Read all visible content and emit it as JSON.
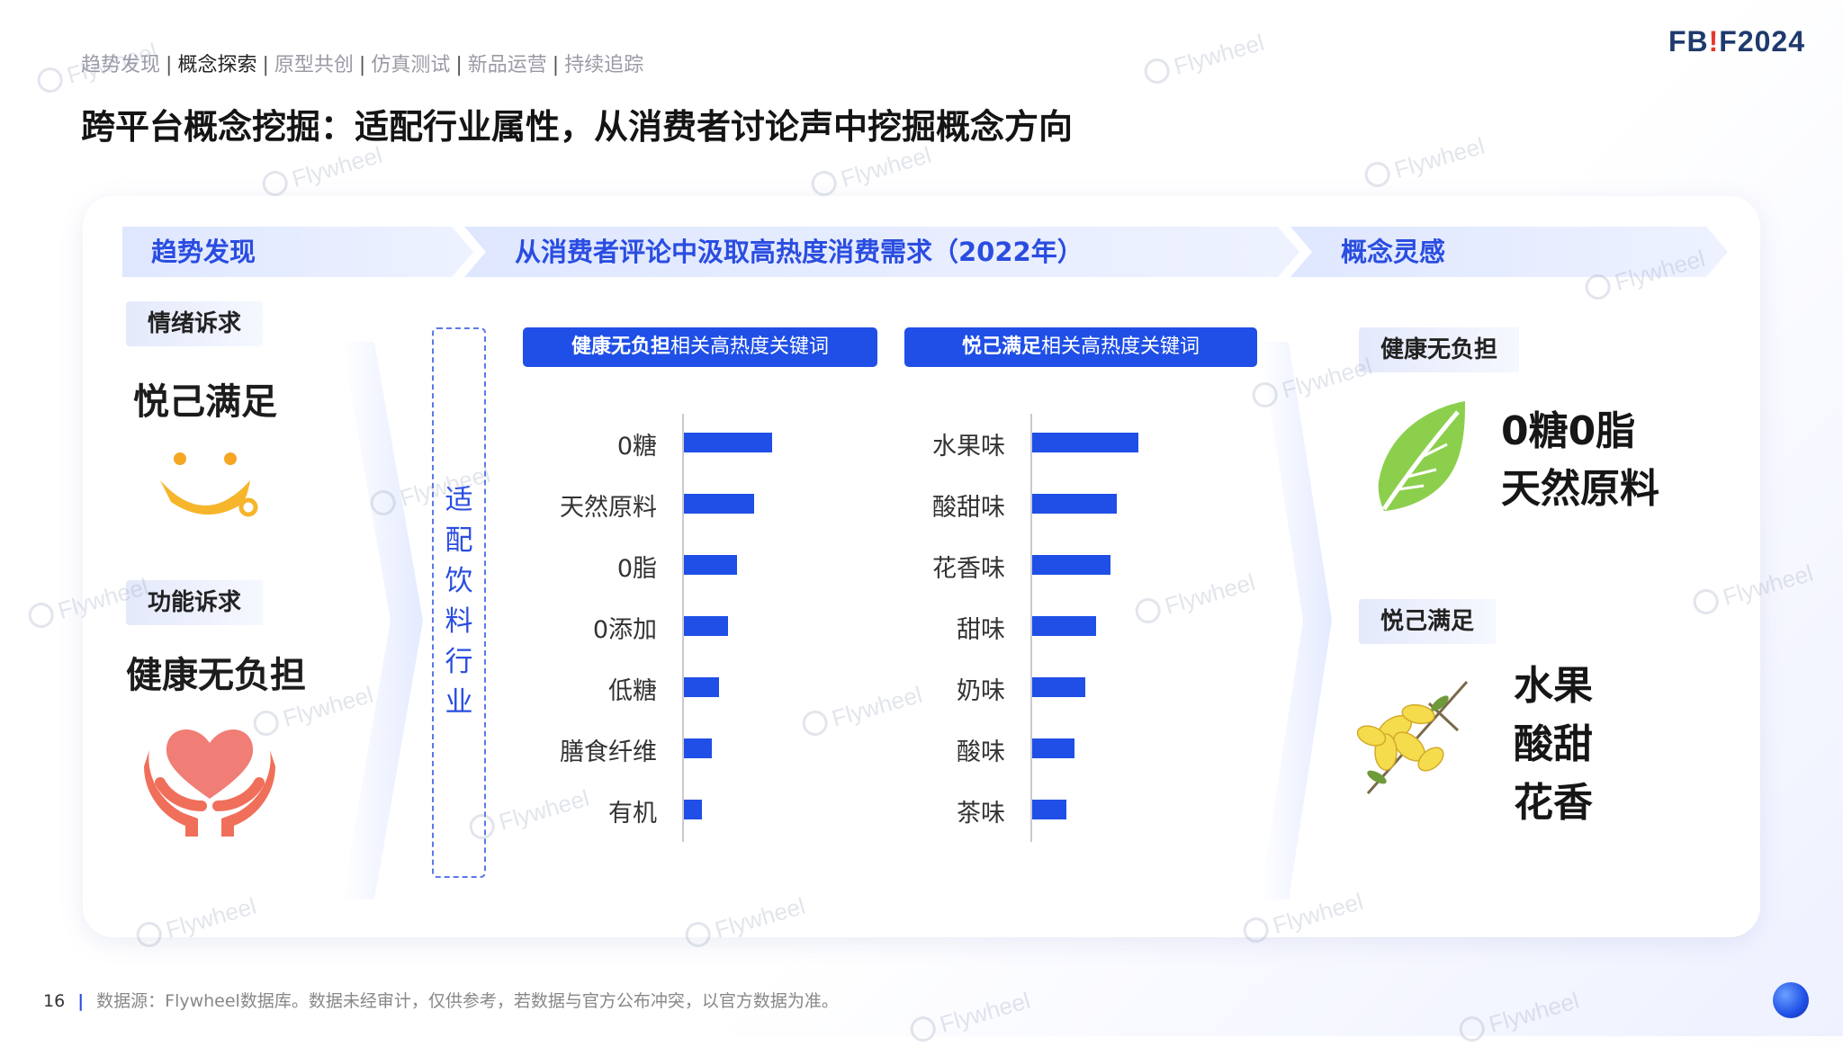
{
  "breadcrumb": {
    "items": [
      "趋势发现",
      "概念探索",
      "原型共创",
      "仿真测试",
      "新品运营",
      "持续追踪"
    ],
    "active_index": 1
  },
  "logo": {
    "text_a": "FB",
    "text_bang": "!",
    "text_b": "F2024"
  },
  "title": "跨平台概念挖掘：适配行业属性，从消费者讨论声中挖掘概念方向",
  "sections": {
    "left": "趋势发现",
    "middle": "从消费者评论中汲取高热度消费需求（2022年）",
    "right": "概念灵感"
  },
  "left_panel": {
    "emotional": {
      "tag": "情绪诉求",
      "value": "悦己满足",
      "icon": "smile-icon"
    },
    "functional": {
      "tag": "功能诉求",
      "value": "健康无负担",
      "icon": "heart-hands-icon"
    }
  },
  "adapt_label": "适配饮料行业",
  "chart_data": [
    {
      "type": "bar",
      "orientation": "horizontal",
      "title_bold": "健康无负担",
      "title_rest": "相关高热度关键词",
      "categories": [
        "0糖",
        "天然原料",
        "0脂",
        "0添加",
        "低糖",
        "膳食纤维",
        "有机"
      ],
      "values": [
        100,
        80,
        60,
        50,
        40,
        32,
        20
      ]
    },
    {
      "type": "bar",
      "orientation": "horizontal",
      "title_bold": "悦己满足",
      "title_rest": "相关高热度关键词",
      "categories": [
        "水果味",
        "酸甜味",
        "花香味",
        "甜味",
        "奶味",
        "酸味",
        "茶味"
      ],
      "values": [
        100,
        80,
        74,
        60,
        50,
        40,
        32
      ]
    }
  ],
  "right_panel": {
    "health": {
      "tag": "健康无负担",
      "lines": [
        "0糖0脂",
        "天然原料"
      ],
      "icon": "leaf-icon"
    },
    "pleasure": {
      "tag": "悦己满足",
      "lines": [
        "水果",
        "酸甜",
        "花香"
      ],
      "icon": "flower-icon"
    }
  },
  "footer": {
    "page": "16",
    "source": "数据源：Flywheel数据库。数据未经审计，仅供参考，若数据与官方公布冲突，以官方数据为准。"
  },
  "watermark": "Flywheel",
  "colors": {
    "accent": "#1f4fe6",
    "band": "#dfe7ff",
    "title": "#2a4de0"
  }
}
